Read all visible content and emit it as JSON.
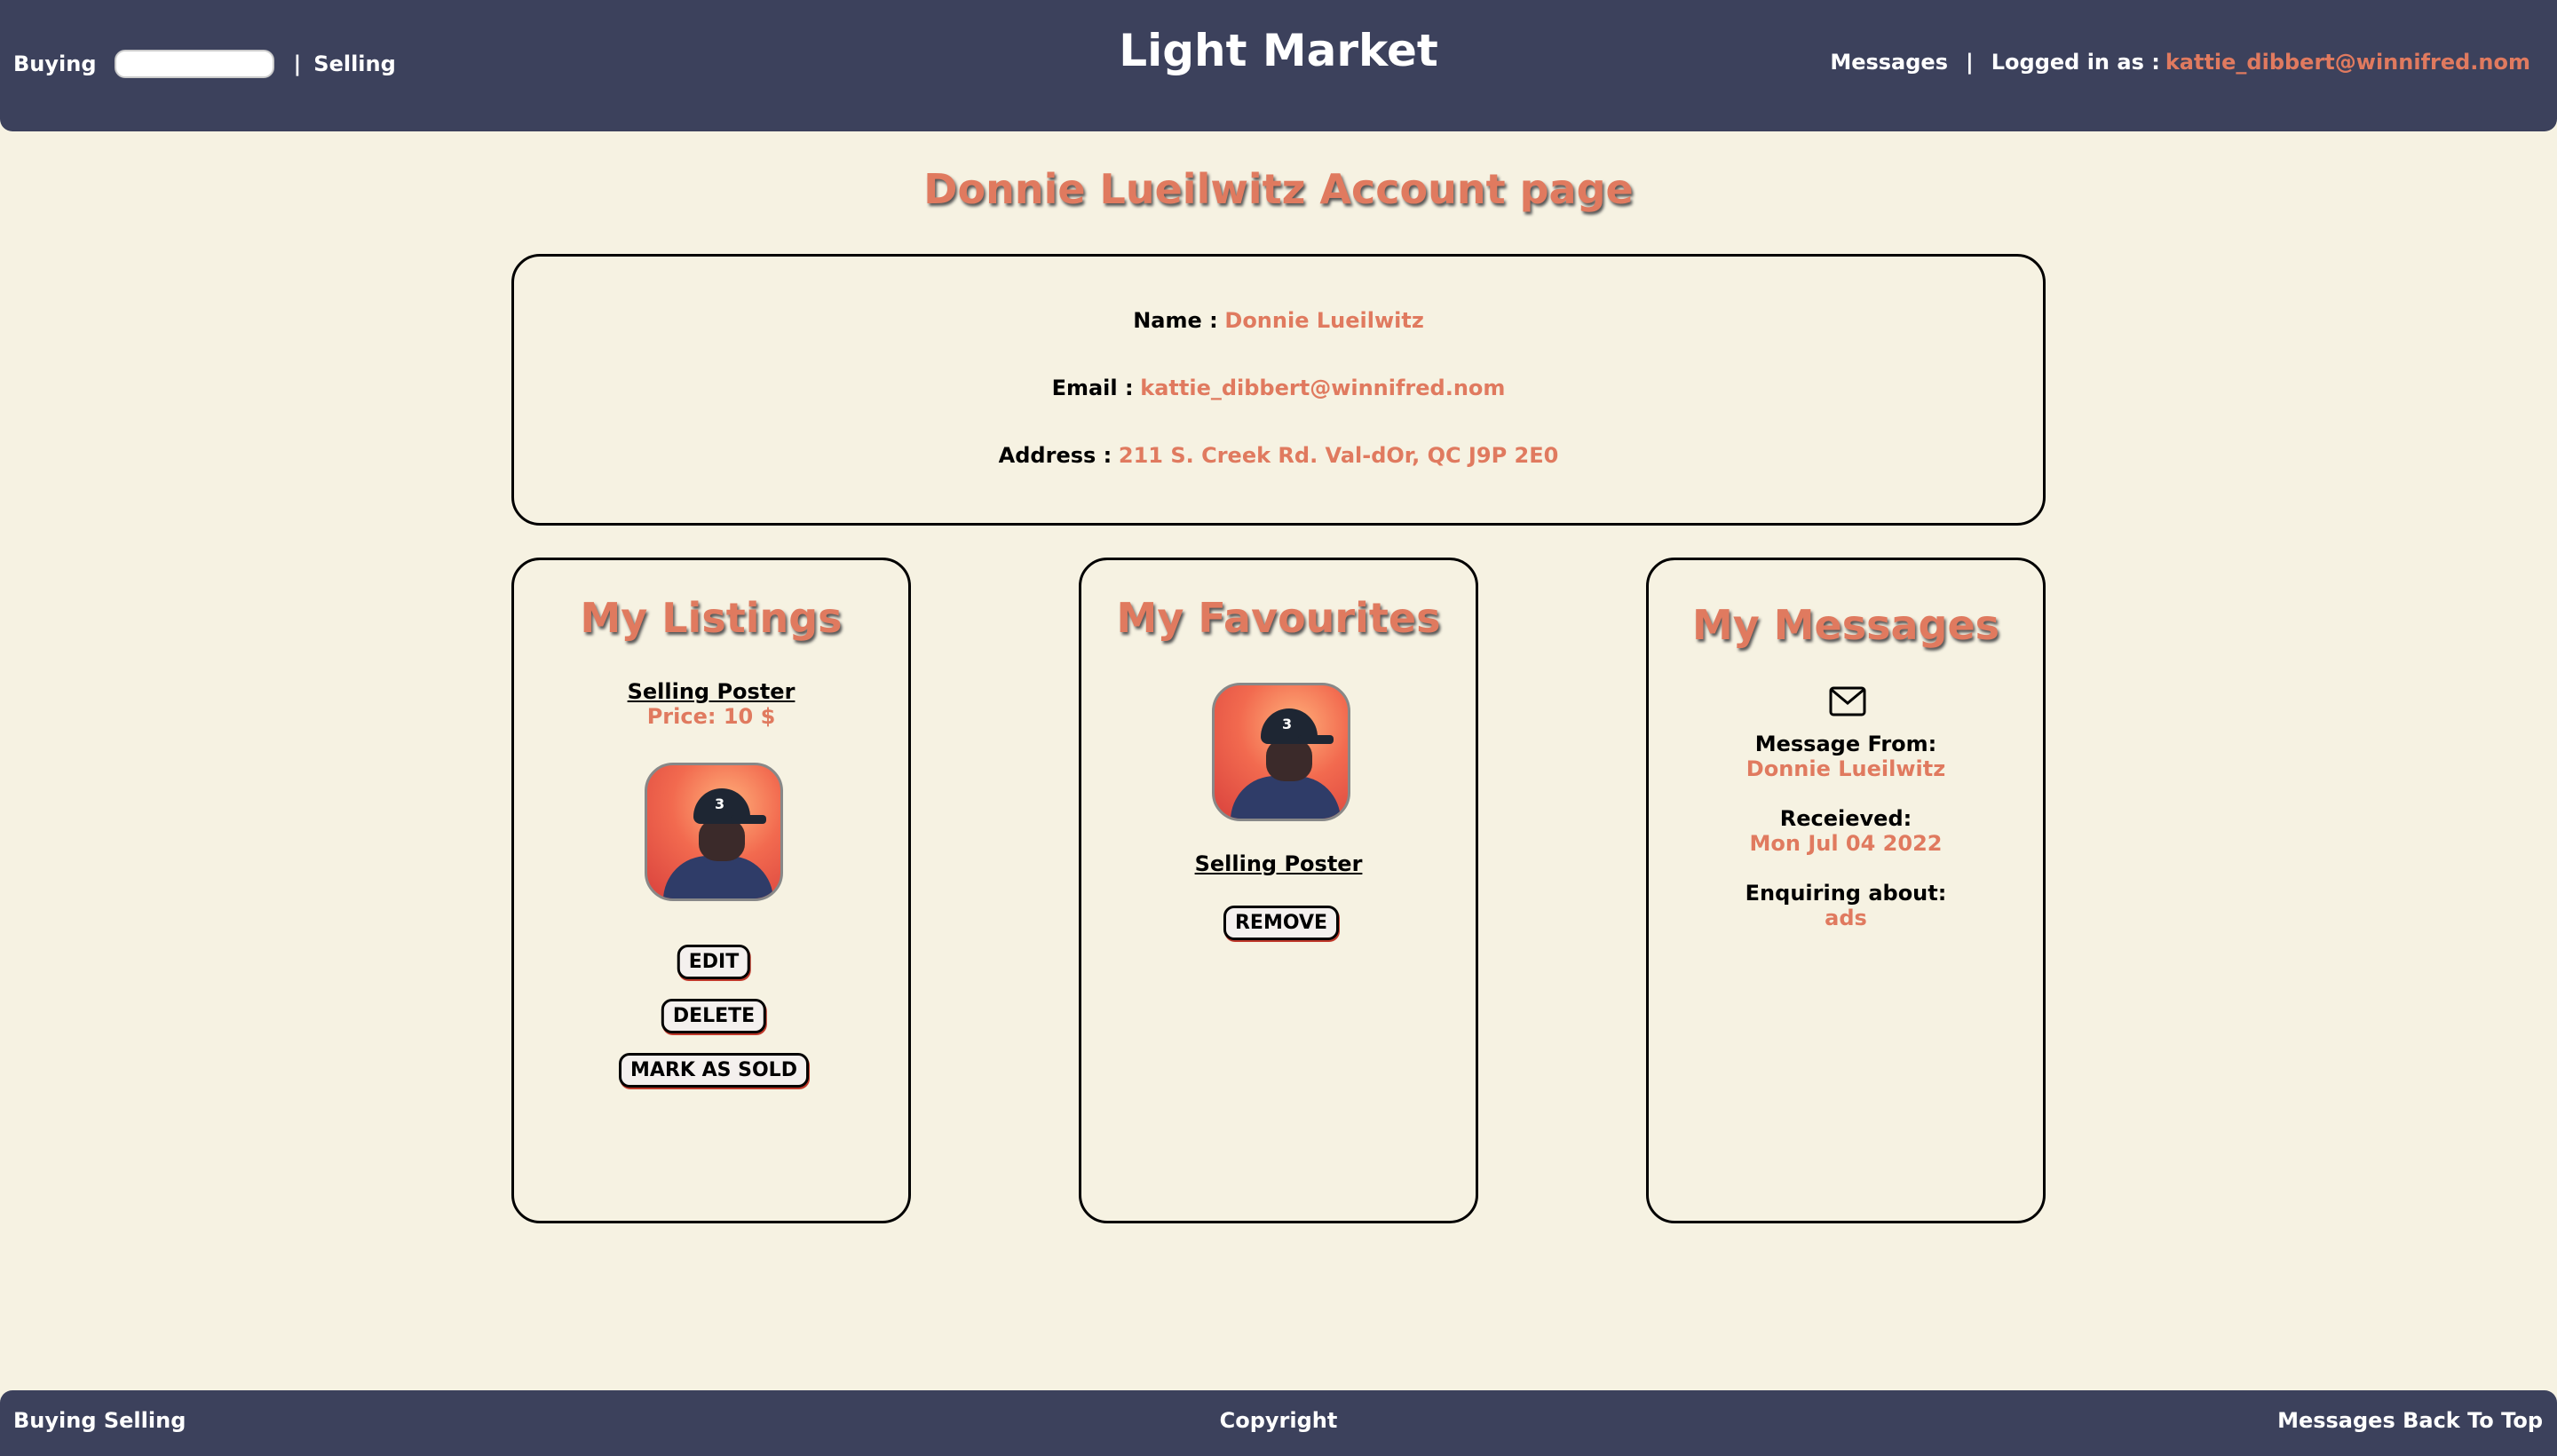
{
  "header": {
    "buying": "Buying",
    "separator": "|",
    "selling": "Selling",
    "brand": "Light Market",
    "messages": "Messages",
    "logged_in_label": "Logged in as :",
    "user_email": "kattie_dibbert@winnifred.nom"
  },
  "page_title": "Donnie Lueilwitz Account page",
  "account": {
    "name_label": "Name :",
    "name_value": "Donnie Lueilwitz",
    "email_label": "Email :",
    "email_value": "kattie_dibbert@winnifred.nom",
    "address_label": "Address :",
    "address_value": "211 S. Creek Rd. Val-dOr, QC J9P 2E0"
  },
  "listings": {
    "title": "My Listings",
    "item_title": "Selling Poster",
    "item_price": "Price: 10 $",
    "edit_label": "EDIT",
    "delete_label": "DELETE",
    "sold_label": "MARK AS SOLD"
  },
  "favourites": {
    "title": "My Favourites",
    "item_title": "Selling Poster",
    "remove_label": "REMOVE"
  },
  "messages": {
    "title": "My Messages",
    "from_label": "Message From:",
    "from_value": "Donnie Lueilwitz",
    "received_label": "Receieved:",
    "received_value": "Mon Jul 04 2022",
    "about_label": "Enquiring about:",
    "about_value": "ads"
  },
  "footer": {
    "left": "Buying Selling",
    "center": "Copyright",
    "right": "Messages Back To Top"
  },
  "colors": {
    "accent": "#e07a5f",
    "navbar": "#3c415c",
    "background": "#f6f2e2"
  }
}
